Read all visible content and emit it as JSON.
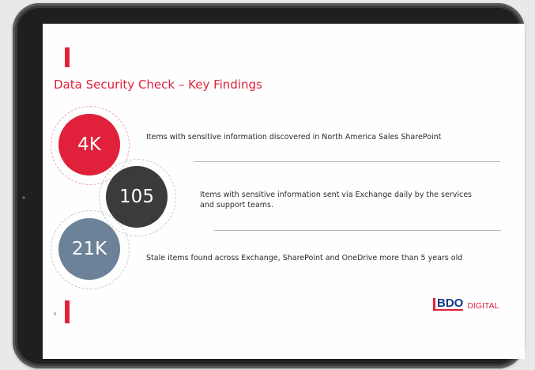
{
  "slide": {
    "title": "Data Security Check – Key Findings",
    "page_number": "6"
  },
  "findings": [
    {
      "value": "4K",
      "text": "Items with sensitive information discovered in North America Sales SharePoint",
      "color": "#e1213b"
    },
    {
      "value": "105",
      "text": "Items with sensitive information sent via Exchange daily by the services and support teams.",
      "color": "#3b3b3b"
    },
    {
      "value": "21K",
      "text": "Stale items found across Exchange, SharePoint and OneDrive more than 5 years old",
      "color": "#6c8299"
    }
  ],
  "logo": {
    "mark": "BDO",
    "text": "DIGITAL"
  },
  "colors": {
    "accent": "#e1213b",
    "tablet_frame": "#3a3a3a",
    "background": "#e9e9e9"
  }
}
